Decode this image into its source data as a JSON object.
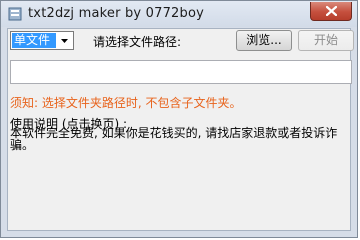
{
  "window": {
    "title": "txt2dzj maker by 0772boy"
  },
  "toolbar": {
    "mode_selected": "单文件",
    "path_label": "请选择文件路径:",
    "browse_label": "浏览...",
    "start_label": "开始"
  },
  "path_input": {
    "value": ""
  },
  "notice": "须知: 选择文件夹路径时, 不包含子文件夹。",
  "usage": {
    "title": "使用说明 (点击换页) :",
    "text": "本软件完全免费, 如果你是花钱买的, 请找店家退款或者投诉诈骗。"
  },
  "colors": {
    "notice": "#e8631c",
    "selection": "#3399ff",
    "close_button": "#c54f3d"
  }
}
